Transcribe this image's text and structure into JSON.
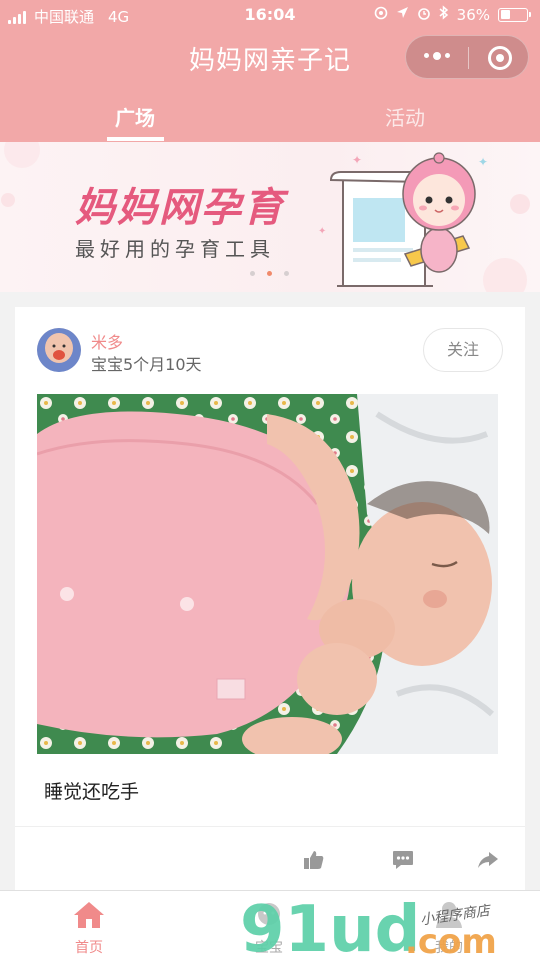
{
  "status_bar": {
    "carrier": "中国联通",
    "network": "4G",
    "time": "16:04",
    "battery_percent": "36%",
    "battery_level": 0.36
  },
  "nav": {
    "title": "妈妈网亲子记",
    "tabs": [
      {
        "label": "广场",
        "active": true
      },
      {
        "label": "活动",
        "active": false
      }
    ]
  },
  "banner": {
    "title": "妈妈网孕育",
    "subtitle": "最好用的孕育工具",
    "page_count": 3,
    "active_page": 2
  },
  "post": {
    "username": "米多",
    "baby_age": "宝宝5个月10天",
    "follow_label": "关注",
    "text": "睡觉还吃手",
    "actions": [
      "like-icon",
      "comment-icon",
      "share-icon"
    ]
  },
  "tabbar": {
    "items": [
      {
        "label": "首页",
        "icon": "home-icon",
        "active": true
      },
      {
        "label": "宝宝",
        "icon": "baby-icon",
        "active": false
      },
      {
        "label": "我的",
        "icon": "user-icon",
        "active": false
      }
    ]
  },
  "watermark": {
    "brand": "91ud",
    "suffix": ".com",
    "tagline": "小程序商店"
  },
  "colors": {
    "header_pink": "#f2a8a8",
    "accent_pink": "#f08a8a",
    "banner_title": "#e55a7e"
  }
}
